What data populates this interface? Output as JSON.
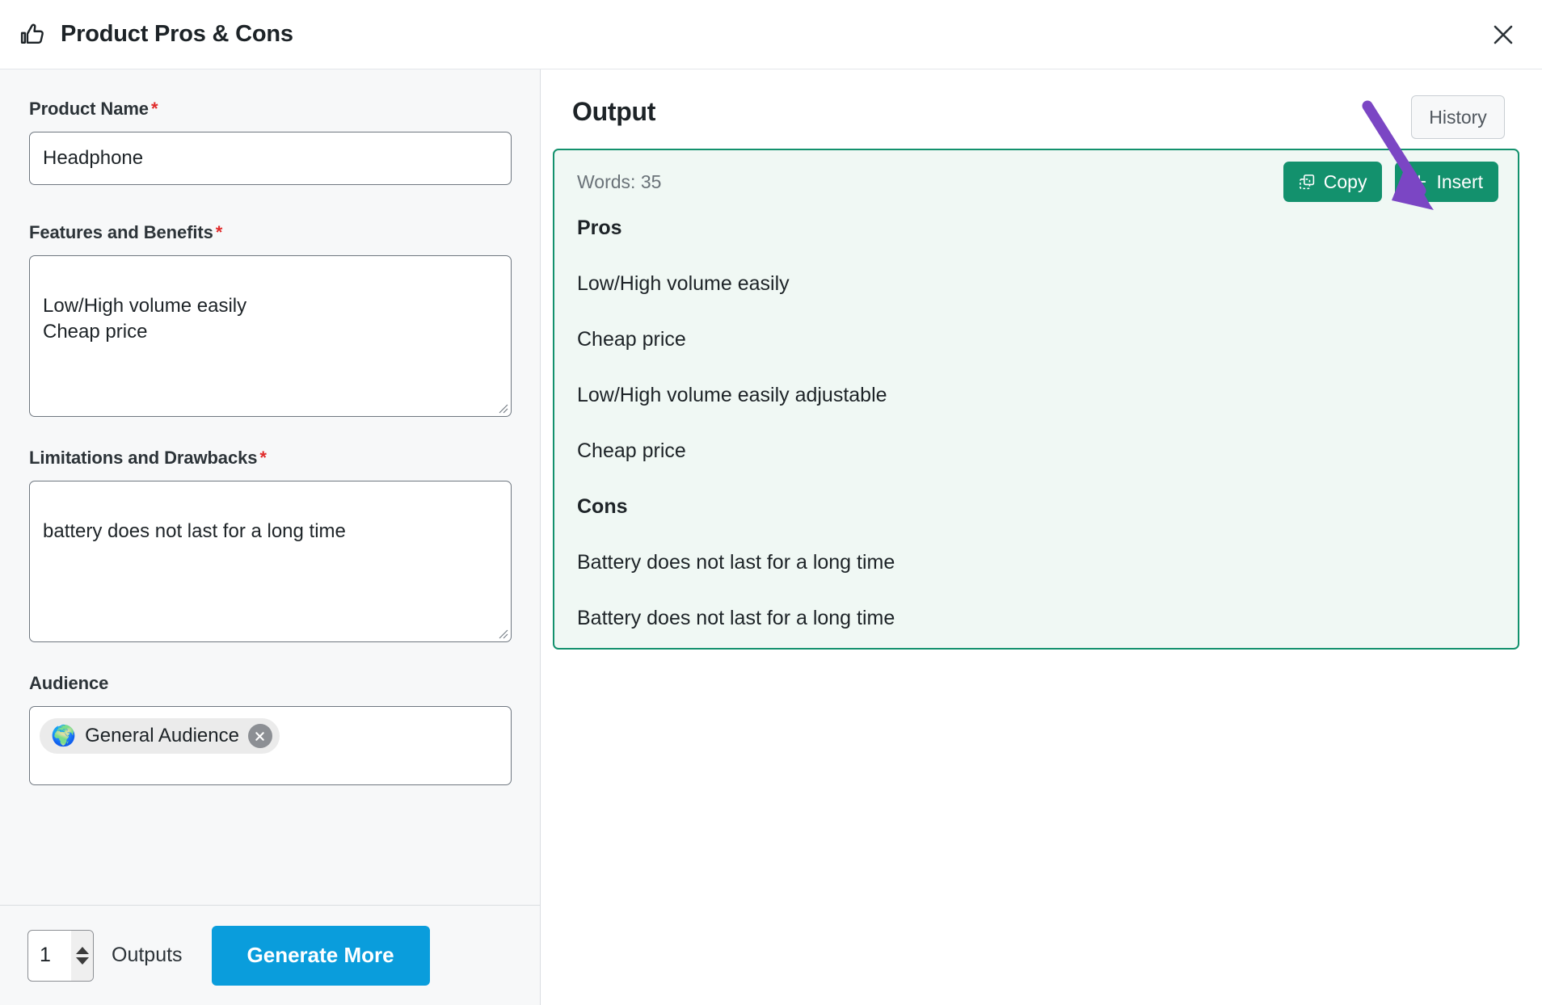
{
  "header": {
    "icon": "thumbs-up-icon",
    "title": "Product Pros & Cons",
    "close_icon": "close-icon"
  },
  "form": {
    "product_name": {
      "label": "Product Name",
      "required_marker": "*",
      "value": "Headphone",
      "placeholder": ""
    },
    "features": {
      "label": "Features and Benefits",
      "required_marker": "*",
      "value": "Low/High volume easily\nCheap price",
      "placeholder": ""
    },
    "limitations": {
      "label": "Limitations and Drawbacks",
      "required_marker": "*",
      "value": "battery does not last for a long time",
      "placeholder": ""
    },
    "audience": {
      "label": "Audience",
      "chip_emoji": "🌍",
      "chip_label": "General Audience",
      "chip_remove_icon": "close-circle-icon"
    }
  },
  "bottom_bar": {
    "outputs_count": "1",
    "outputs_label": "Outputs",
    "generate_label": "Generate More"
  },
  "output": {
    "title": "Output",
    "history_label": "History",
    "words_label": "Words: 35",
    "copy_label": "Copy",
    "insert_label": "Insert",
    "insert_plus": "+",
    "sections": {
      "pros_heading": "Pros",
      "pros": [
        "Low/High volume easily",
        "Cheap price",
        "Low/High volume easily adjustable",
        "Cheap price"
      ],
      "cons_heading": "Cons",
      "cons": [
        "Battery does not last for a long time",
        "Battery does not last for a long time"
      ]
    }
  },
  "annotation": {
    "type": "arrow",
    "points_to": "insert-button",
    "color": "#7b46c4"
  },
  "colors": {
    "accent_blue": "#0a9ddc",
    "accent_green": "#13916d",
    "card_bg": "#f0f8f4",
    "panel_bg": "#f7f8f9",
    "required_red": "#e02b2b",
    "annotation_purple": "#7b46c4"
  }
}
